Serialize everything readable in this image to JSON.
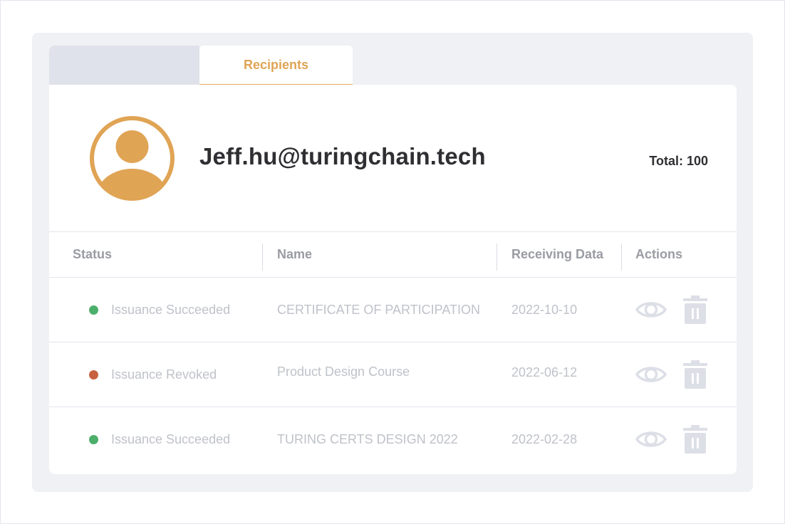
{
  "tabs": [
    {
      "label": ""
    },
    {
      "label": "Recipients",
      "active": true
    }
  ],
  "profile": {
    "email": "Jeff.hu@turingchain.tech",
    "total_label": "Total: 100"
  },
  "table": {
    "columns": [
      "Status",
      "Name",
      "Receiving Data",
      "Actions"
    ],
    "rows": [
      {
        "status": "Issuance Succeeded",
        "status_color": "#4caf6a",
        "name": "CERTIFICATE OF PARTICIPATION",
        "date": "2022-10-10"
      },
      {
        "status": "Issuance Revoked",
        "status_color": "#c8613f",
        "name": "Product Design Course",
        "date": "2022-06-12"
      },
      {
        "status": "Issuance Succeeded",
        "status_color": "#4caf6a",
        "name": "TURING CERTS DESIGN 2022",
        "date": "2022-02-28"
      }
    ]
  },
  "icons": {
    "avatar": "user-avatar-icon",
    "view": "eye-icon",
    "delete": "trash-icon"
  },
  "colors": {
    "accent": "#e3a95b",
    "succeeded": "#4caf6a",
    "revoked": "#c8613f"
  }
}
